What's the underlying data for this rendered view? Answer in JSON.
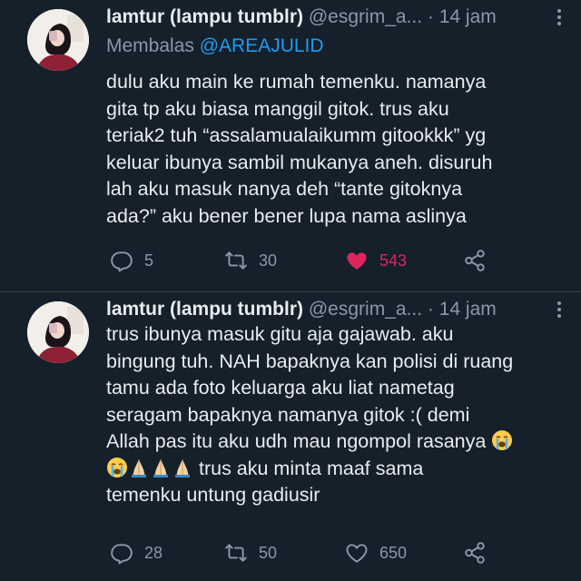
{
  "tweets": [
    {
      "name": "lamtur (lampu tumblr)",
      "handle": "@esgrim_a...",
      "time": "· 14 jam",
      "reply_prefix": "Membalas ",
      "reply_mention": "@AREAJULID",
      "lines": [
        "dulu aku main ke rumah temenku. namanya",
        "gita tp aku biasa manggil gitok. trus aku",
        "teriak2 tuh “assalamualaikumm gitookkk” yg",
        "keluar ibunya sambil mukanya aneh. disuruh",
        "lah aku masuk nanya deh “tante gitoknya",
        "ada?” aku bener bener lupa nama aslinya"
      ],
      "replies": "5",
      "retweets": "30",
      "likes": "543",
      "liked": true
    },
    {
      "name": "lamtur (lampu tumblr)",
      "handle": "@esgrim_a...",
      "time": "· 14 jam",
      "lines": [
        "trus ibunya masuk gitu aja gajawab. aku",
        "bingung tuh. NAH bapaknya kan polisi di ruang",
        "tamu ada foto keluarga aku liat nametag",
        "seragam bapaknya namanya gitok :( demi",
        "Allah pas itu aku udh mau ngompol rasanya",
        "trus aku minta maaf sama",
        "temenku untung gadiusir"
      ],
      "emojis": [
        "loudly-crying-face",
        "loudly-crying-face",
        "folded-hands",
        "folded-hands",
        "folded-hands"
      ],
      "replies": "28",
      "retweets": "50",
      "likes": "650",
      "liked": false
    }
  ],
  "colors": {
    "background": "#15202b",
    "text": "#e7ecf0",
    "secondary": "#8b98a5",
    "link": "#1d9bf0",
    "like": "#e0245e",
    "divider": "#38444d"
  },
  "icons": {
    "reply": "reply-icon",
    "retweet": "retweet-icon",
    "like": "heart-icon",
    "share": "share-icon",
    "more": "more-icon"
  }
}
